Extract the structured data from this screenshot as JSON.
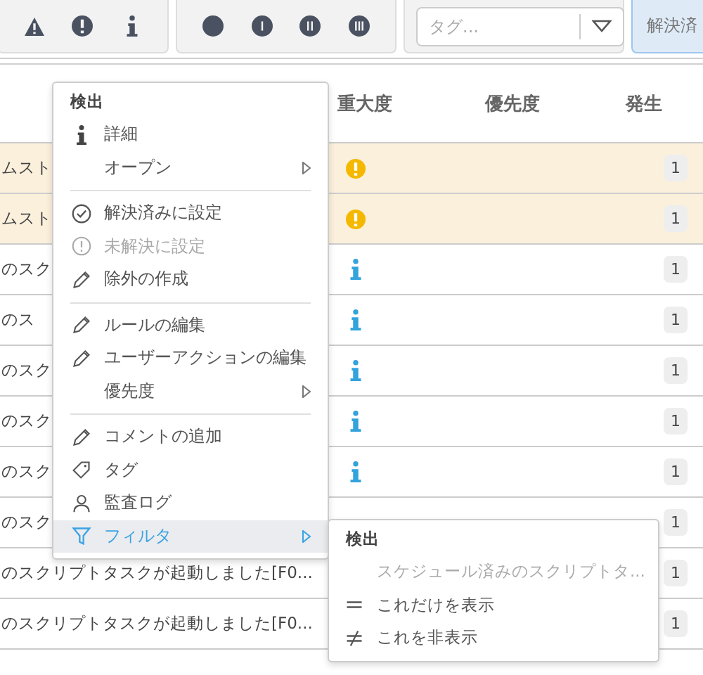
{
  "toolbar": {
    "severity_filters": [
      {
        "kind": "warning"
      },
      {
        "kind": "error"
      },
      {
        "kind": "info"
      }
    ],
    "priority_filters": [
      {
        "kind": "p0"
      },
      {
        "kind": "p1"
      },
      {
        "kind": "p2"
      },
      {
        "kind": "p3"
      }
    ],
    "tag_field": {
      "placeholder": "タグ..."
    },
    "resolved_button": "解決済"
  },
  "table": {
    "columns": [
      "重大度",
      "優先度",
      "発生"
    ],
    "rows": [
      {
        "text": "ムスト",
        "kind": "error",
        "count": "1",
        "highlighted": true
      },
      {
        "text": "ムスト",
        "kind": "error",
        "count": "1",
        "highlighted": true
      },
      {
        "text": "のスク",
        "kind": "info",
        "count": "1",
        "highlighted": false
      },
      {
        "text": "のス",
        "kind": "info",
        "count": "1",
        "highlighted": false
      },
      {
        "text": "のスク",
        "kind": "info",
        "count": "1",
        "highlighted": false
      },
      {
        "text": "のスク",
        "kind": "info",
        "count": "1",
        "highlighted": false
      },
      {
        "text": "のスク",
        "kind": "info",
        "count": "1",
        "highlighted": false
      },
      {
        "text": "のスク",
        "count": "1",
        "highlighted": false
      },
      {
        "text": "のスクリプトタスクが起動しました[F0...",
        "count": "1",
        "highlighted": false
      },
      {
        "text": "のスクリプトタスクが起動しました[F0...",
        "count": "1",
        "highlighted": false
      }
    ]
  },
  "context_menu": {
    "title": "検出",
    "groups": [
      [
        {
          "label": "詳細",
          "kind": "info",
          "disabled": false,
          "submenu": false,
          "selected": false
        },
        {
          "label": "オープン",
          "kind": "plain",
          "disabled": false,
          "submenu": true,
          "selected": false
        }
      ],
      [
        {
          "label": "解決済みに設定",
          "kind": "check",
          "disabled": false,
          "submenu": false,
          "selected": false
        },
        {
          "label": "未解決に設定",
          "kind": "alert",
          "disabled": true,
          "submenu": false,
          "selected": false
        },
        {
          "label": "除外の作成",
          "kind": "pencil",
          "disabled": false,
          "submenu": false,
          "selected": false
        }
      ],
      [
        {
          "label": "ルールの編集",
          "kind": "pencil",
          "disabled": false,
          "submenu": false,
          "selected": false
        },
        {
          "label": "ユーザーアクションの編集",
          "kind": "pencil",
          "disabled": false,
          "submenu": false,
          "selected": false
        },
        {
          "label": "優先度",
          "kind": "plain",
          "disabled": false,
          "submenu": true,
          "selected": false
        }
      ],
      [
        {
          "label": "コメントの追加",
          "kind": "pencil",
          "disabled": false,
          "submenu": false,
          "selected": false
        },
        {
          "label": "タグ",
          "kind": "tag",
          "disabled": false,
          "submenu": false,
          "selected": false
        },
        {
          "label": "監査ログ",
          "kind": "user",
          "disabled": false,
          "submenu": false,
          "selected": false
        },
        {
          "label": "フィルタ",
          "kind": "filter",
          "disabled": false,
          "submenu": true,
          "selected": true
        }
      ]
    ]
  },
  "submenu": {
    "title": "検出",
    "items": [
      {
        "label": "スケジュール済みのスクリプトタ...",
        "kind": "plain",
        "disabled": true
      },
      {
        "label": "これだけを表示",
        "kind": "equal",
        "disabled": false
      },
      {
        "label": "これを非表示",
        "kind": "notequal",
        "disabled": false
      }
    ]
  }
}
